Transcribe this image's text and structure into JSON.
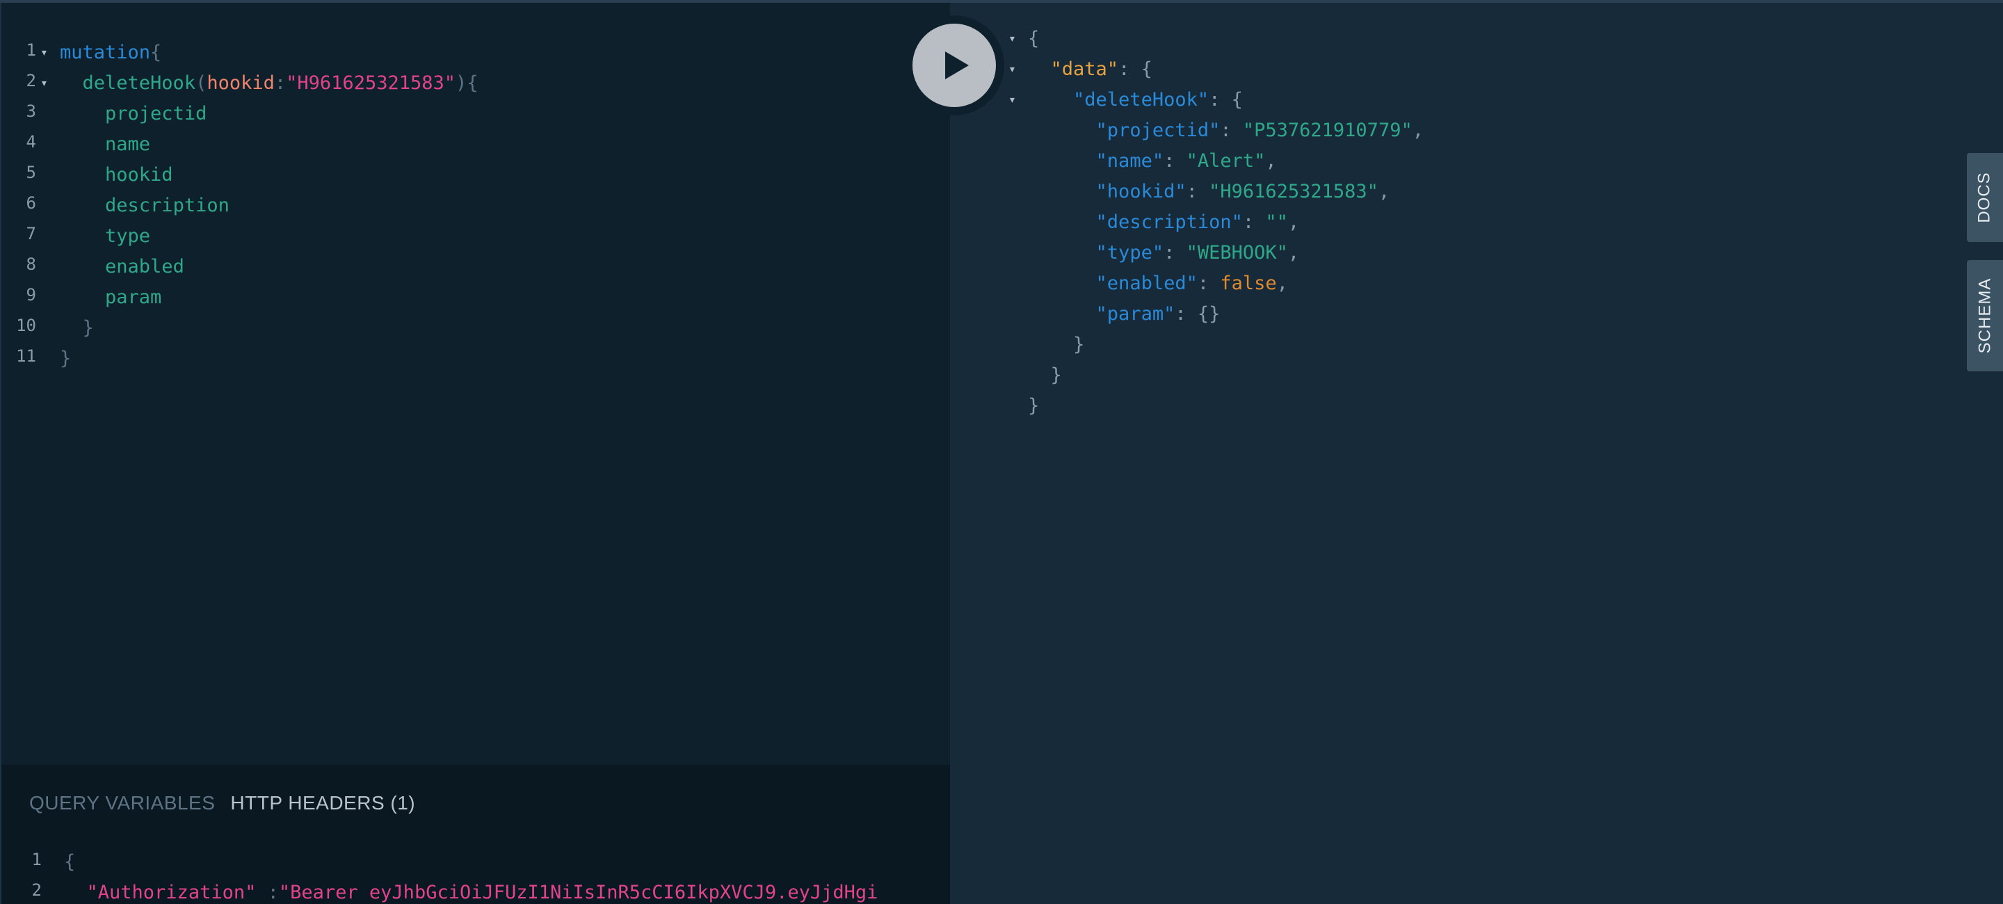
{
  "editor": {
    "lines": [
      {
        "n": "1",
        "fold": true,
        "indent": "",
        "parts": [
          {
            "t": "mutation",
            "c": "kw"
          },
          {
            "t": "{",
            "c": "pun"
          }
        ]
      },
      {
        "n": "2",
        "fold": true,
        "indent": "  ",
        "parts": [
          {
            "t": "deleteHook",
            "c": "fld"
          },
          {
            "t": "(",
            "c": "pun"
          },
          {
            "t": "hookid",
            "c": "arg"
          },
          {
            "t": ":",
            "c": "pun"
          },
          {
            "t": "\"H961625321583\"",
            "c": "str"
          },
          {
            "t": "){",
            "c": "pun"
          }
        ]
      },
      {
        "n": "3",
        "fold": false,
        "indent": "    ",
        "parts": [
          {
            "t": "projectid",
            "c": "fld"
          }
        ]
      },
      {
        "n": "4",
        "fold": false,
        "indent": "    ",
        "parts": [
          {
            "t": "name",
            "c": "fld"
          }
        ]
      },
      {
        "n": "5",
        "fold": false,
        "indent": "    ",
        "parts": [
          {
            "t": "hookid",
            "c": "fld"
          }
        ]
      },
      {
        "n": "6",
        "fold": false,
        "indent": "    ",
        "parts": [
          {
            "t": "description",
            "c": "fld"
          }
        ]
      },
      {
        "n": "7",
        "fold": false,
        "indent": "    ",
        "parts": [
          {
            "t": "type",
            "c": "fld"
          }
        ]
      },
      {
        "n": "8",
        "fold": false,
        "indent": "    ",
        "parts": [
          {
            "t": "enabled",
            "c": "fld"
          }
        ]
      },
      {
        "n": "9",
        "fold": false,
        "indent": "    ",
        "parts": [
          {
            "t": "param",
            "c": "fld"
          }
        ]
      },
      {
        "n": "10",
        "fold": false,
        "indent": "  ",
        "parts": [
          {
            "t": "}",
            "c": "pun"
          }
        ]
      },
      {
        "n": "11",
        "fold": false,
        "indent": "",
        "parts": [
          {
            "t": "}",
            "c": "pun"
          }
        ]
      }
    ]
  },
  "bottom_panel": {
    "tabs": [
      "QUERY VARIABLES",
      "HTTP HEADERS (1)"
    ],
    "active_tab": 1,
    "lines": [
      {
        "n": "1",
        "indent": "",
        "parts": [
          {
            "t": "{",
            "c": "pun"
          }
        ]
      },
      {
        "n": "2",
        "indent": "  ",
        "parts": [
          {
            "t": "\"Authorization\"",
            "c": "str"
          },
          {
            "t": " :",
            "c": "pun"
          },
          {
            "t": "\"Bearer eyJhbGciOiJFUzI1NiIsInR5cCI6IkpXVCJ9.eyJjdHgi",
            "c": "str"
          }
        ]
      }
    ]
  },
  "result": {
    "lines": [
      {
        "fold": true,
        "indent": "",
        "parts": [
          {
            "t": "{",
            "c": "rpun"
          }
        ]
      },
      {
        "fold": true,
        "indent": "  ",
        "parts": [
          {
            "t": "\"data\"",
            "c": "key-top"
          },
          {
            "t": ": {",
            "c": "rpun"
          }
        ]
      },
      {
        "fold": true,
        "indent": "    ",
        "parts": [
          {
            "t": "\"deleteHook\"",
            "c": "key"
          },
          {
            "t": ": {",
            "c": "rpun"
          }
        ]
      },
      {
        "fold": false,
        "indent": "      ",
        "parts": [
          {
            "t": "\"projectid\"",
            "c": "key"
          },
          {
            "t": ": ",
            "c": "rpun"
          },
          {
            "t": "\"P537621910779\"",
            "c": "sval"
          },
          {
            "t": ",",
            "c": "rpun"
          }
        ]
      },
      {
        "fold": false,
        "indent": "      ",
        "parts": [
          {
            "t": "\"name\"",
            "c": "key"
          },
          {
            "t": ": ",
            "c": "rpun"
          },
          {
            "t": "\"Alert\"",
            "c": "sval"
          },
          {
            "t": ",",
            "c": "rpun"
          }
        ]
      },
      {
        "fold": false,
        "indent": "      ",
        "parts": [
          {
            "t": "\"hookid\"",
            "c": "key"
          },
          {
            "t": ": ",
            "c": "rpun"
          },
          {
            "t": "\"H961625321583\"",
            "c": "sval"
          },
          {
            "t": ",",
            "c": "rpun"
          }
        ]
      },
      {
        "fold": false,
        "indent": "      ",
        "parts": [
          {
            "t": "\"description\"",
            "c": "key"
          },
          {
            "t": ": ",
            "c": "rpun"
          },
          {
            "t": "\"\"",
            "c": "sval"
          },
          {
            "t": ",",
            "c": "rpun"
          }
        ]
      },
      {
        "fold": false,
        "indent": "      ",
        "parts": [
          {
            "t": "\"type\"",
            "c": "key"
          },
          {
            "t": ": ",
            "c": "rpun"
          },
          {
            "t": "\"WEBHOOK\"",
            "c": "sval"
          },
          {
            "t": ",",
            "c": "rpun"
          }
        ]
      },
      {
        "fold": false,
        "indent": "      ",
        "parts": [
          {
            "t": "\"enabled\"",
            "c": "key"
          },
          {
            "t": ": ",
            "c": "rpun"
          },
          {
            "t": "false",
            "c": "bval"
          },
          {
            "t": ",",
            "c": "rpun"
          }
        ]
      },
      {
        "fold": false,
        "indent": "      ",
        "parts": [
          {
            "t": "\"param\"",
            "c": "key"
          },
          {
            "t": ": {}",
            "c": "rpun"
          }
        ]
      },
      {
        "fold": false,
        "indent": "    ",
        "parts": [
          {
            "t": "}",
            "c": "rpun"
          }
        ]
      },
      {
        "fold": false,
        "indent": "  ",
        "parts": [
          {
            "t": "}",
            "c": "rpun"
          }
        ]
      },
      {
        "fold": false,
        "indent": "",
        "parts": [
          {
            "t": "}",
            "c": "rpun"
          }
        ]
      }
    ]
  },
  "side_tabs": {
    "docs": "DOCS",
    "schema": "SCHEMA"
  },
  "icons": {
    "run": "play-icon",
    "fold": "caret-down-icon"
  },
  "colors": {
    "editor_bg": "#0f202d",
    "result_bg": "#172a3a",
    "keyword": "#2a8ad8",
    "field": "#2fa88a",
    "argument": "#f0846a",
    "string": "#e2438c",
    "json_top_key": "#e6a33e",
    "json_boolean": "#e08a2e"
  }
}
